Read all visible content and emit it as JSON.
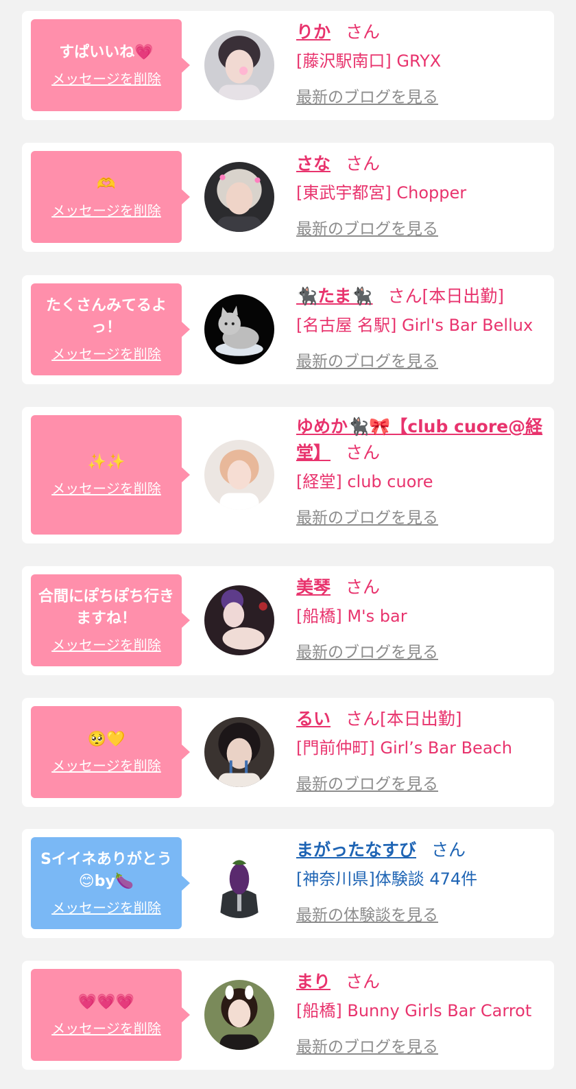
{
  "colors": {
    "accent_pink": "#e8336d",
    "bubble_pink": "#ff8fab",
    "bubble_blue": "#7ab8f5",
    "link_blue": "#1e64b4",
    "muted_gray": "#8c8c8c",
    "card_bg": "#ffffff",
    "page_bg": "#f2f2f2"
  },
  "items": [
    {
      "message": "すぱいいね💗",
      "delete_label": "メッセージを削除",
      "avatar_icon": "girl-photo-avatar",
      "name": "りか",
      "suffix": "さん",
      "shop": "[藤沢駅南口] GRYX",
      "blog_link": "最新のブログを見る",
      "bubble_color": "pink"
    },
    {
      "message": "🫶",
      "delete_label": "メッセージを削除",
      "avatar_icon": "girl-photo-avatar",
      "name": "さな",
      "suffix": "さん",
      "shop": "[東武宇都宮] Chopper",
      "blog_link": "最新のブログを見る",
      "bubble_color": "pink"
    },
    {
      "message": "たくさんみてるよっ！",
      "delete_label": "メッセージを削除",
      "avatar_icon": "cat-illustration-avatar",
      "name": "🐈‍⬛たま🐈‍⬛",
      "suffix": "さん[本日出勤]",
      "shop": "[名古屋 名駅] Girl's Bar Bellux",
      "blog_link": "最新のブログを見る",
      "bubble_color": "pink"
    },
    {
      "message": "✨✨",
      "delete_label": "メッセージを削除",
      "avatar_icon": "girl-photo-avatar",
      "name": "ゆめか🐈‍⬛🎀【club cuore@経堂】",
      "suffix": "さん",
      "shop": "[経堂] club cuore",
      "blog_link": "最新のブログを見る",
      "bubble_color": "pink"
    },
    {
      "message": "合間にぽちぽち行きますね！",
      "delete_label": "メッセージを削除",
      "avatar_icon": "girl-photo-avatar",
      "name": "美琴",
      "suffix": "さん",
      "shop": "[船橋] M's bar",
      "blog_link": "最新のブログを見る",
      "bubble_color": "pink"
    },
    {
      "message": "🥺💛",
      "delete_label": "メッセージを削除",
      "avatar_icon": "girl-photo-avatar",
      "name": "るい",
      "suffix": "さん[本日出勤]",
      "shop": "[門前仲町] Girl’s Bar Beach",
      "blog_link": "最新のブログを見る",
      "bubble_color": "pink"
    },
    {
      "message": "Sイイネありがとう😊by🍆",
      "delete_label": "メッセージを削除",
      "avatar_icon": "eggplant-suit-avatar",
      "name": "まがったなすび",
      "suffix": "さん",
      "shop": "[神奈川県]体験談 474件",
      "blog_link": "最新の体験談を見る",
      "bubble_color": "blue"
    },
    {
      "message": "💗💗💗",
      "delete_label": "メッセージを削除",
      "avatar_icon": "girl-photo-avatar",
      "name": "まり",
      "suffix": "さん",
      "shop": "[船橋] Bunny Girls Bar Carrot",
      "blog_link": "最新のブログを見る",
      "bubble_color": "pink"
    }
  ]
}
